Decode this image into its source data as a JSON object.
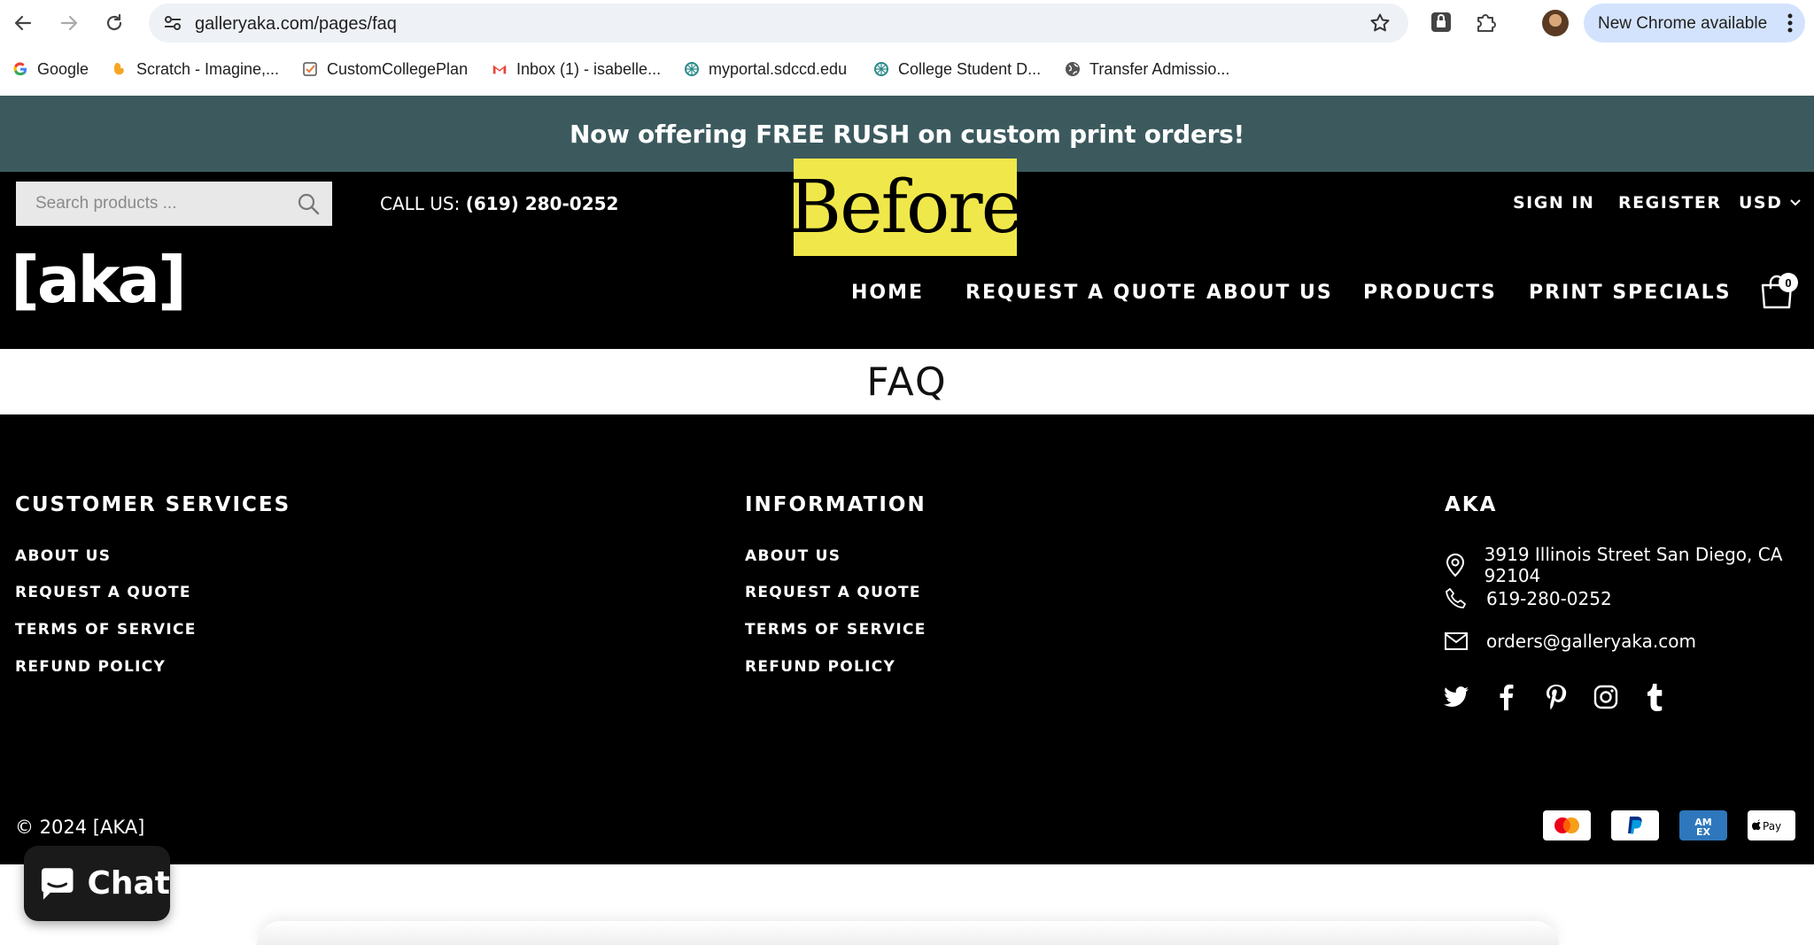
{
  "browser": {
    "url": "galleryaka.com/pages/faq",
    "update_label": "New Chrome available",
    "bookmarks": [
      {
        "label": "Google",
        "icon": "google-icon"
      },
      {
        "label": "Scratch - Imagine,...",
        "icon": "scratch-icon"
      },
      {
        "label": "CustomCollegePlan",
        "icon": "checklist-icon"
      },
      {
        "label": "Inbox (1) - isabelle...",
        "icon": "gmail-icon"
      },
      {
        "label": "myportal.sdccd.edu",
        "icon": "portal-icon"
      },
      {
        "label": "College Student D...",
        "icon": "portal-icon"
      },
      {
        "label": "Transfer Admissio...",
        "icon": "globe-icon"
      }
    ]
  },
  "promo": {
    "text": "Now offering FREE RUSH on custom print orders!"
  },
  "header": {
    "search_placeholder": "Search products ...",
    "call_label": "CALL US:",
    "call_number": "(619) 280-0252",
    "before_label": "Before",
    "sign_in": "SIGN IN",
    "register": "REGISTER",
    "currency": "USD",
    "logo": "[aka]",
    "nav": [
      "HOME",
      "REQUEST A QUOTE",
      "ABOUT US",
      "PRODUCTS",
      "PRINT SPECIALS"
    ],
    "cart_count": "0"
  },
  "page": {
    "title": "FAQ"
  },
  "footer": {
    "customer_services": {
      "heading": "CUSTOMER SERVICES",
      "links": [
        "ABOUT US",
        "REQUEST A QUOTE",
        "TERMS OF SERVICE",
        "REFUND POLICY"
      ]
    },
    "information": {
      "heading": "INFORMATION",
      "links": [
        "ABOUT US",
        "REQUEST A QUOTE",
        "TERMS OF SERVICE",
        "REFUND POLICY"
      ]
    },
    "aka": {
      "heading": "AKA",
      "address": "3919 Illinois Street San Diego, CA 92104",
      "phone": "619-280-0252",
      "email": "orders@galleryaka.com"
    },
    "social": [
      "twitter-icon",
      "facebook-icon",
      "pinterest-icon",
      "instagram-icon",
      "tumblr-icon"
    ],
    "copyright": "© 2024 [AKA]",
    "payments": [
      "mastercard-icon",
      "paypal-icon",
      "amex-icon",
      "apple-pay-icon"
    ]
  },
  "chat": {
    "label": "Chat"
  },
  "colors": {
    "promo_bg": "#3c5a5e",
    "highlight": "#f0e84a",
    "footer_bg": "#000000"
  }
}
